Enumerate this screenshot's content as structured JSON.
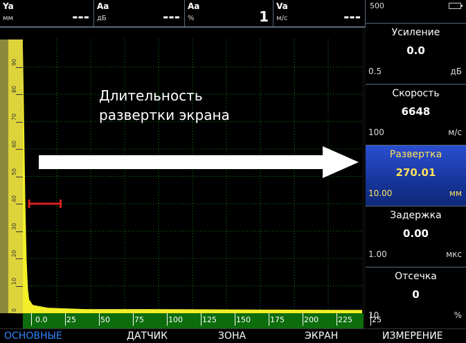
{
  "readouts": [
    {
      "name": "Ya",
      "unit": "мм",
      "value": "---"
    },
    {
      "name": "Aa",
      "unit": "дБ",
      "value": "---"
    },
    {
      "name": "Aa",
      "unit": "%",
      "value": "1"
    },
    {
      "name": "Va",
      "unit": "м/с",
      "value": "---"
    }
  ],
  "status": {
    "battery_text": "500"
  },
  "params": [
    {
      "name": "Усиление",
      "value": "0.0",
      "step": "0.5",
      "unit": "дБ"
    },
    {
      "name": "Скорость",
      "value": "6648",
      "step": "100",
      "unit": "м/с"
    },
    {
      "name": "Развертка",
      "value": "270.01",
      "step": "10.00",
      "unit": "мм"
    },
    {
      "name": "Задержка",
      "value": "0.00",
      "step": "1.00",
      "unit": "мкс"
    },
    {
      "name": "Отсечка",
      "value": "0",
      "step": "10",
      "unit": "%"
    }
  ],
  "annotation": {
    "line1": "Длительность",
    "line2": "развертки экрана"
  },
  "chart_data": {
    "type": "line",
    "x_ticks": [
      "0.0",
      "25",
      "50",
      "75",
      "100",
      "125",
      "150",
      "175",
      "200",
      "225",
      "25"
    ],
    "y_ticks": [
      "0",
      "10",
      "20",
      "30",
      "40",
      "50",
      "60",
      "70",
      "80",
      "90"
    ],
    "ylim": [
      0,
      100
    ],
    "grid": true,
    "trace": [
      [
        0,
        98
      ],
      [
        1,
        70
      ],
      [
        2,
        40
      ],
      [
        3,
        20
      ],
      [
        4,
        9
      ],
      [
        5,
        5
      ],
      [
        8,
        3
      ],
      [
        20,
        2
      ],
      [
        50,
        1.5
      ],
      [
        100,
        1.5
      ],
      [
        200,
        1.3
      ],
      [
        270,
        1.2
      ]
    ],
    "gate_mark": {
      "x_start": 5,
      "x_end": 30,
      "y": 40
    }
  },
  "menu": [
    {
      "label": "ОСНОВНЫЕ",
      "active": true
    },
    {
      "label": "ДАТЧИК",
      "active": false
    },
    {
      "label": "ЗОНА",
      "active": false
    },
    {
      "label": "ЭКРАН",
      "active": false
    },
    {
      "label": "ИЗМЕРЕНИЕ",
      "active": false
    }
  ],
  "colors": {
    "accent": "#2f86ff",
    "trace": "#f2ef28",
    "grid": "#1a8a1a",
    "gate": "#d92020",
    "active_param": "#1f44b8"
  }
}
